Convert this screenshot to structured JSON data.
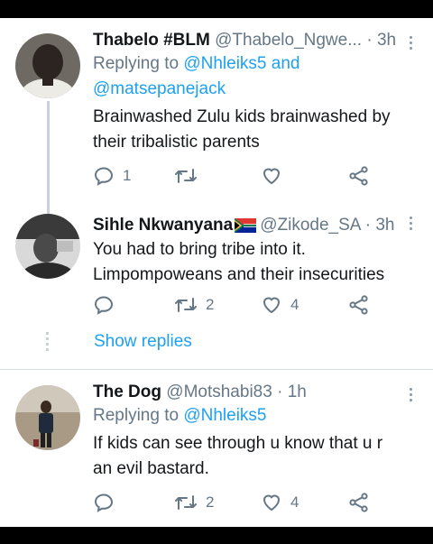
{
  "tweets": [
    {
      "name": "Thabelo #BLM",
      "handle": "@Thabelo_Ngwe...",
      "sep": "·",
      "time": "3h",
      "replying_prefix": "Replying to",
      "replying_to": [
        "@Nhleiks5",
        "@matsepanejack"
      ],
      "replying_and": "and",
      "text": "Brainwashed Zulu kids brainwashed by their tribalistic parents",
      "reply_count": "1",
      "retweet_count": "",
      "like_count": ""
    },
    {
      "name": "Sihle Nkwanyana",
      "flag_icon": "south-africa-flag-icon",
      "handle": "@Zikode_SA",
      "sep": "·",
      "time": "3h",
      "text": "You had to bring tribe into it. Limpompoweans and their insecurities",
      "reply_count": "",
      "retweet_count": "2",
      "like_count": "4"
    },
    {
      "name": "The Dog",
      "handle": "@Motshabi83",
      "sep": "·",
      "time": "1h",
      "replying_prefix": "Replying to",
      "replying_to": [
        "@Nhleiks5"
      ],
      "text": "If kids can see through u know that u r an evil bastard.",
      "reply_count": "",
      "retweet_count": "2",
      "like_count": "4"
    }
  ],
  "show_replies": "Show replies",
  "colors": {
    "link": "#1da1f2",
    "secondary": "#657786",
    "text": "#14171a",
    "thread_line": "#c9d2d9"
  }
}
